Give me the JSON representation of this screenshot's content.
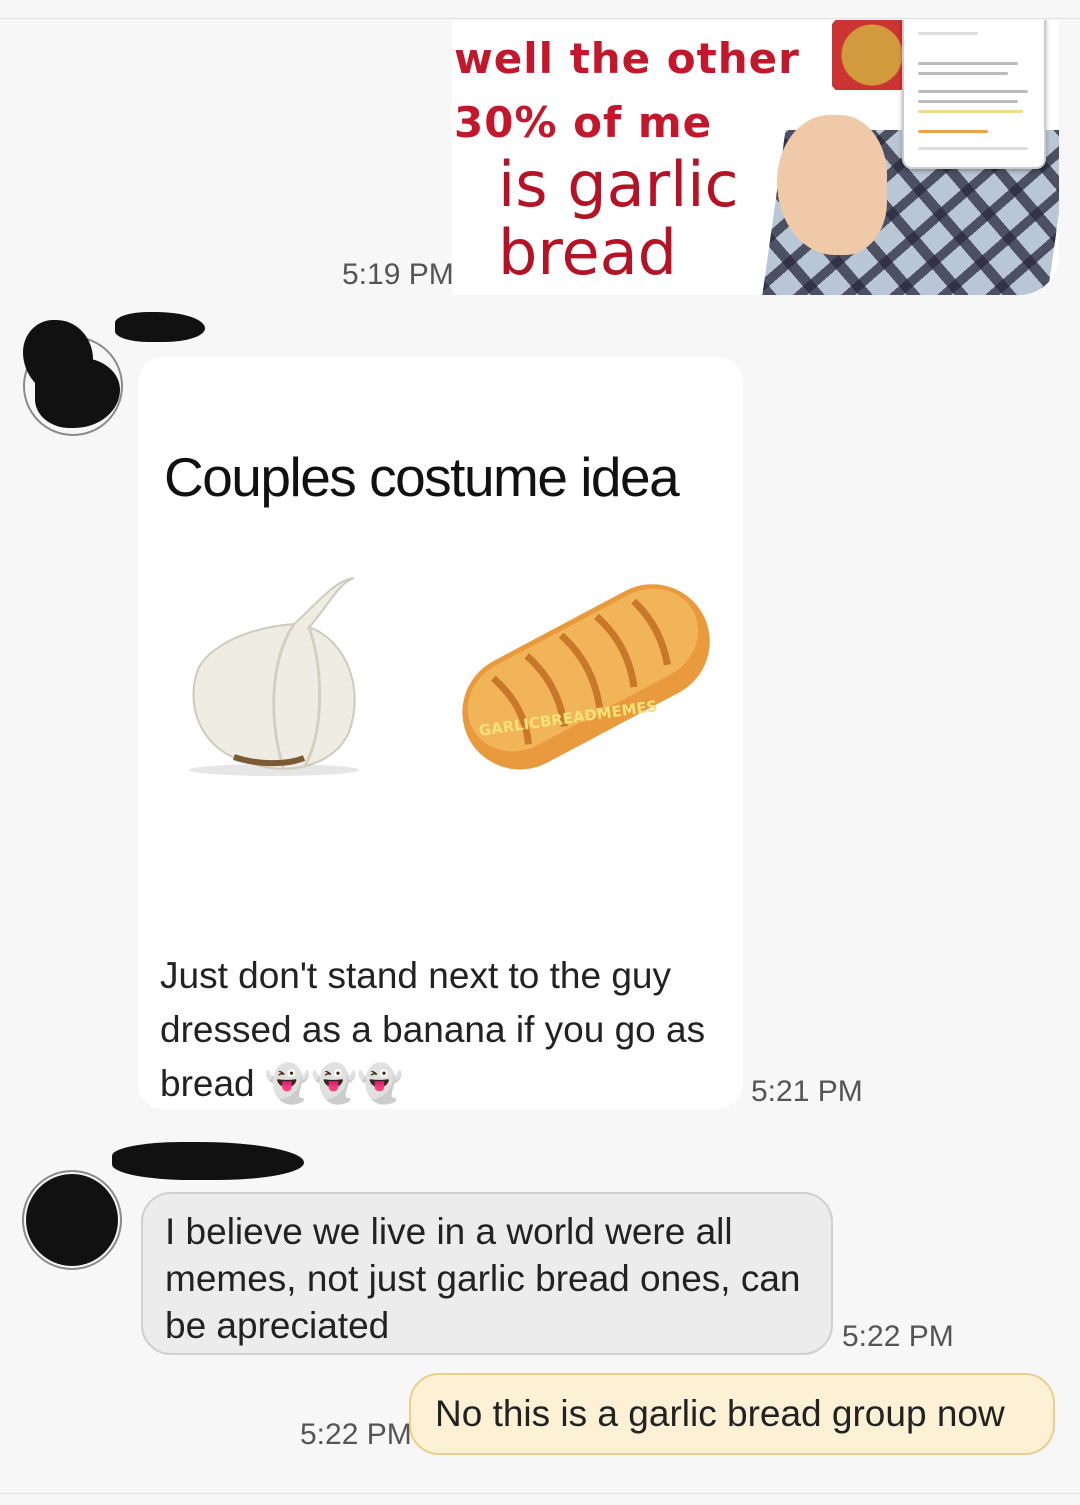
{
  "thread": {
    "messages": [
      {
        "direction": "sent",
        "kind": "image",
        "time": "5:19 PM",
        "meme_lines": [
          "well the other",
          "30% of me",
          "is garlic",
          "bread"
        ]
      },
      {
        "direction": "received",
        "kind": "image",
        "time": "5:21 PM",
        "meme_title": "Couples costume idea",
        "watermark": "GARLICBREADMEMES",
        "caption": "Just don't stand next to the guy dressed as a banana if you go as bread 👻👻👻"
      },
      {
        "direction": "received",
        "kind": "text",
        "time": "5:22 PM",
        "text": "I believe we live in a world were all memes, not just garlic bread ones, can be apreciated"
      },
      {
        "direction": "sent",
        "kind": "text",
        "time": "5:22 PM",
        "text": "No this is a garlic bread group now"
      }
    ]
  },
  "colors": {
    "background": "#f7f7f7",
    "sent_bubble": "#fcf1d4",
    "sent_bubble_border": "#e7cf8e",
    "received_bubble": "#ececec",
    "meme_red": "#c4172b"
  }
}
